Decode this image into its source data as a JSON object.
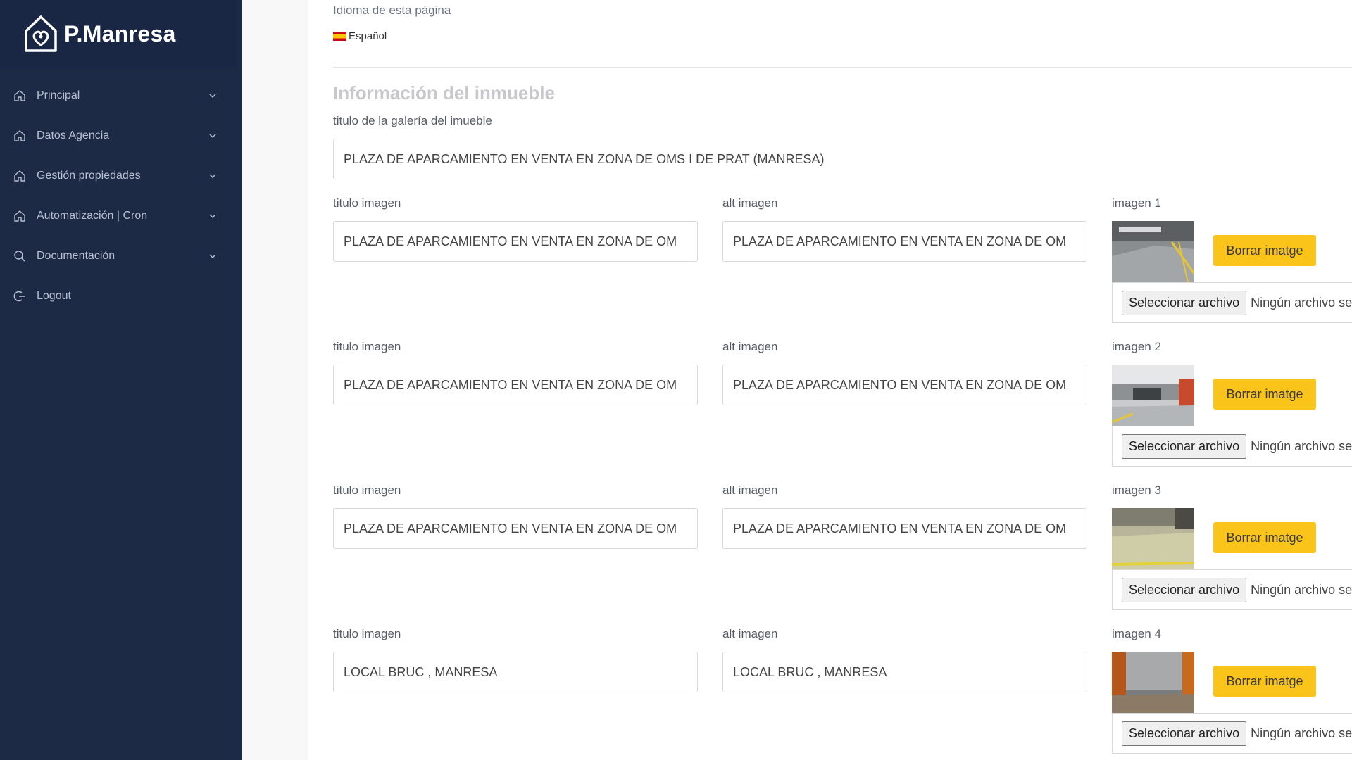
{
  "brand": {
    "name": "P.Manresa"
  },
  "sidebar": {
    "items": [
      {
        "label": "Principal",
        "icon": "home-icon",
        "has_chevron": true
      },
      {
        "label": "Datos Agencia",
        "icon": "home-icon",
        "has_chevron": true
      },
      {
        "label": "Gestión propiedades",
        "icon": "home-icon",
        "has_chevron": true
      },
      {
        "label": "Automatización | Cron",
        "icon": "home-icon",
        "has_chevron": true
      },
      {
        "label": "Documentación",
        "icon": "search-icon",
        "has_chevron": true
      },
      {
        "label": "Logout",
        "icon": "logout-icon",
        "has_chevron": false
      }
    ]
  },
  "language": {
    "label": "Idioma de esta página",
    "value": "Español",
    "flag": "spain-flag-icon"
  },
  "section": {
    "title": "Información del inmueble",
    "gallery_label": "titulo de la galería del imueble",
    "gallery_value": "PLAZA DE APARCAMIENTO EN VENTA EN ZONA DE OMS I DE PRAT (MANRESA)"
  },
  "images": [
    {
      "title_label": "titulo imagen",
      "title_value": "PLAZA DE APARCAMIENTO EN VENTA EN ZONA DE OM",
      "alt_label": "alt imagen",
      "alt_value": "PLAZA DE APARCAMIENTO EN VENTA EN ZONA DE OM",
      "image_label": "imagen 1",
      "delete_label": "Borrar imatge",
      "file_button": "Seleccionar archivo",
      "file_status": "Ningún archivo seleccionado"
    },
    {
      "title_label": "titulo imagen",
      "title_value": "PLAZA DE APARCAMIENTO EN VENTA EN ZONA DE OM",
      "alt_label": "alt imagen",
      "alt_value": "PLAZA DE APARCAMIENTO EN VENTA EN ZONA DE OM",
      "image_label": "imagen 2",
      "delete_label": "Borrar imatge",
      "file_button": "Seleccionar archivo",
      "file_status": "Ningún archivo seleccionado"
    },
    {
      "title_label": "titulo imagen",
      "title_value": "PLAZA DE APARCAMIENTO EN VENTA EN ZONA DE OM",
      "alt_label": "alt imagen",
      "alt_value": "PLAZA DE APARCAMIENTO EN VENTA EN ZONA DE OM",
      "image_label": "imagen 3",
      "delete_label": "Borrar imatge",
      "file_button": "Seleccionar archivo",
      "file_status": "Ningún archivo seleccionado"
    },
    {
      "title_label": "titulo imagen",
      "title_value": "LOCAL BRUC , MANRESA",
      "alt_label": "alt imagen",
      "alt_value": "LOCAL BRUC , MANRESA",
      "image_label": "imagen 4",
      "delete_label": "Borrar imatge",
      "file_button": "Seleccionar archivo",
      "file_status": "Ningún archivo seleccionado"
    }
  ],
  "colors": {
    "sidebar_bg": "#1c2a46",
    "button_yellow": "#fbc41a",
    "section_title": "#c8c8cc"
  }
}
